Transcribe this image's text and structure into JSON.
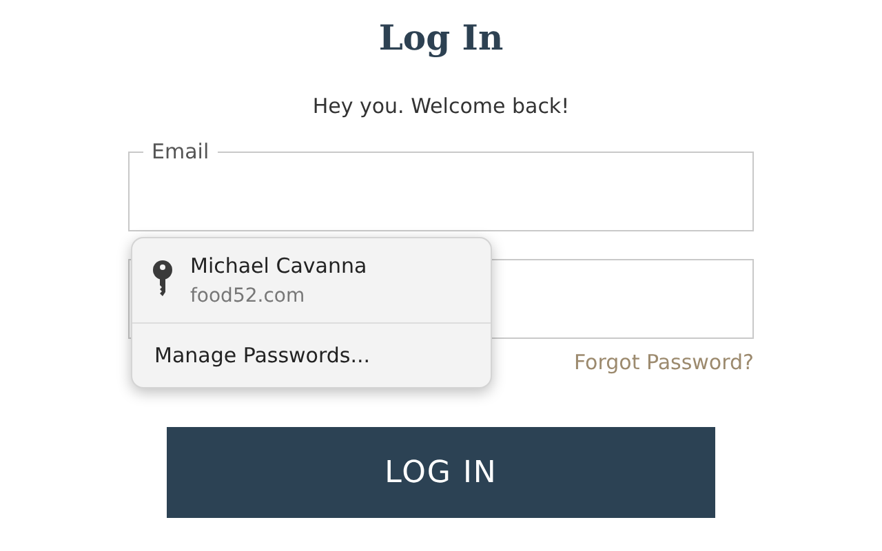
{
  "title": "Log In",
  "subtitle": "Hey you. Welcome back!",
  "email_field": {
    "label": "Email"
  },
  "autofill_popup": {
    "account": {
      "name": "Michael Cavanna",
      "site": "food52.com"
    },
    "manage": "Manage Passwords..."
  },
  "forgot_link": "Forgot Password?",
  "login_button": "LOG IN"
}
